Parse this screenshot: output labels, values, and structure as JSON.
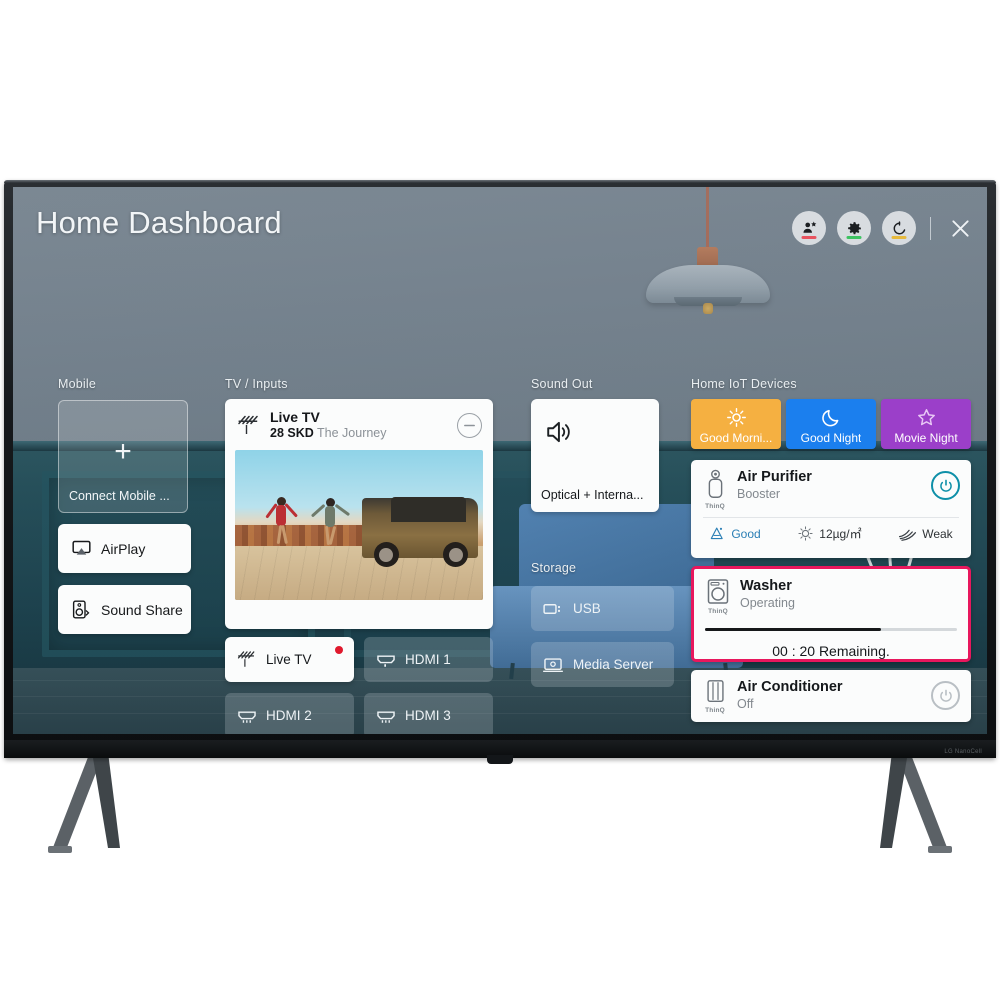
{
  "product": {
    "brand_text": "LG NanoCell"
  },
  "dashboard": {
    "title": "Home Dashboard",
    "topbar": {
      "buttons": [
        {
          "name": "user-profile-icon",
          "label": "User",
          "accent": "#e8535f"
        },
        {
          "name": "gear-icon",
          "label": "Settings",
          "accent": "#3dc261"
        },
        {
          "name": "refresh-icon",
          "label": "Refresh",
          "accent": "#e6b93c"
        }
      ],
      "close_label": "Close"
    },
    "columns": {
      "mobile": {
        "label": "Mobile",
        "connect_tile": {
          "label": "Connect Mobile ...",
          "icon": "plus-icon"
        },
        "buttons": [
          {
            "label": "AirPlay",
            "icon": "airplay-icon"
          },
          {
            "label": "Sound Share",
            "icon": "sound-share-icon"
          }
        ]
      },
      "tv_inputs": {
        "label": "TV / Inputs",
        "preview": {
          "icon": "antenna-icon",
          "title": "Live TV",
          "channel": "28 SKD",
          "program": "The Journey",
          "remove_icon": "minus-circle-icon"
        },
        "sources": [
          {
            "label": "Live TV",
            "icon": "antenna-icon",
            "active": true,
            "badge": true
          },
          {
            "label": "HDMI 1",
            "icon": "hdmi-icon",
            "active": false,
            "badge": false
          },
          {
            "label": "HDMI 2",
            "icon": "hdmi-icon",
            "active": false,
            "badge": false
          },
          {
            "label": "HDMI 3",
            "icon": "hdmi-icon",
            "active": false,
            "badge": false
          }
        ]
      },
      "sound_out": {
        "label": "Sound Out",
        "tile": {
          "label": "Optical + Interna...",
          "icon": "speaker-icon"
        }
      },
      "storage": {
        "label": "Storage",
        "tiles": [
          {
            "label": "USB",
            "icon": "usb-icon"
          },
          {
            "label": "Media Server",
            "icon": "media-server-icon"
          }
        ]
      },
      "home_iot": {
        "label": "Home IoT Devices",
        "scenes": [
          {
            "label": "Good Morni...",
            "icon": "sun-icon",
            "color": "#f5b041"
          },
          {
            "label": "Good Night",
            "icon": "moon-icon",
            "color": "#1b7fee"
          },
          {
            "label": "Movie Night",
            "icon": "star-icon",
            "color": "#9b3fc9"
          }
        ],
        "devices": [
          {
            "name": "Air Purifier",
            "state": "Booster",
            "brand": "ThinQ",
            "icon": "air-purifier-icon",
            "power": "on",
            "stats": [
              {
                "icon": "air-quality-icon",
                "value": "Good"
              },
              {
                "icon": "dust-icon",
                "value": "12µg/㎡"
              },
              {
                "icon": "fan-icon",
                "value": "Weak"
              }
            ]
          },
          {
            "name": "Washer",
            "state": "Operating",
            "brand": "ThinQ",
            "icon": "washer-icon",
            "selected": true,
            "progress_percent": 70,
            "remaining": "00 : 20 Remaining."
          },
          {
            "name": "Air Conditioner",
            "state": "Off",
            "brand": "ThinQ",
            "icon": "air-conditioner-icon",
            "power": "off"
          }
        ]
      }
    }
  }
}
